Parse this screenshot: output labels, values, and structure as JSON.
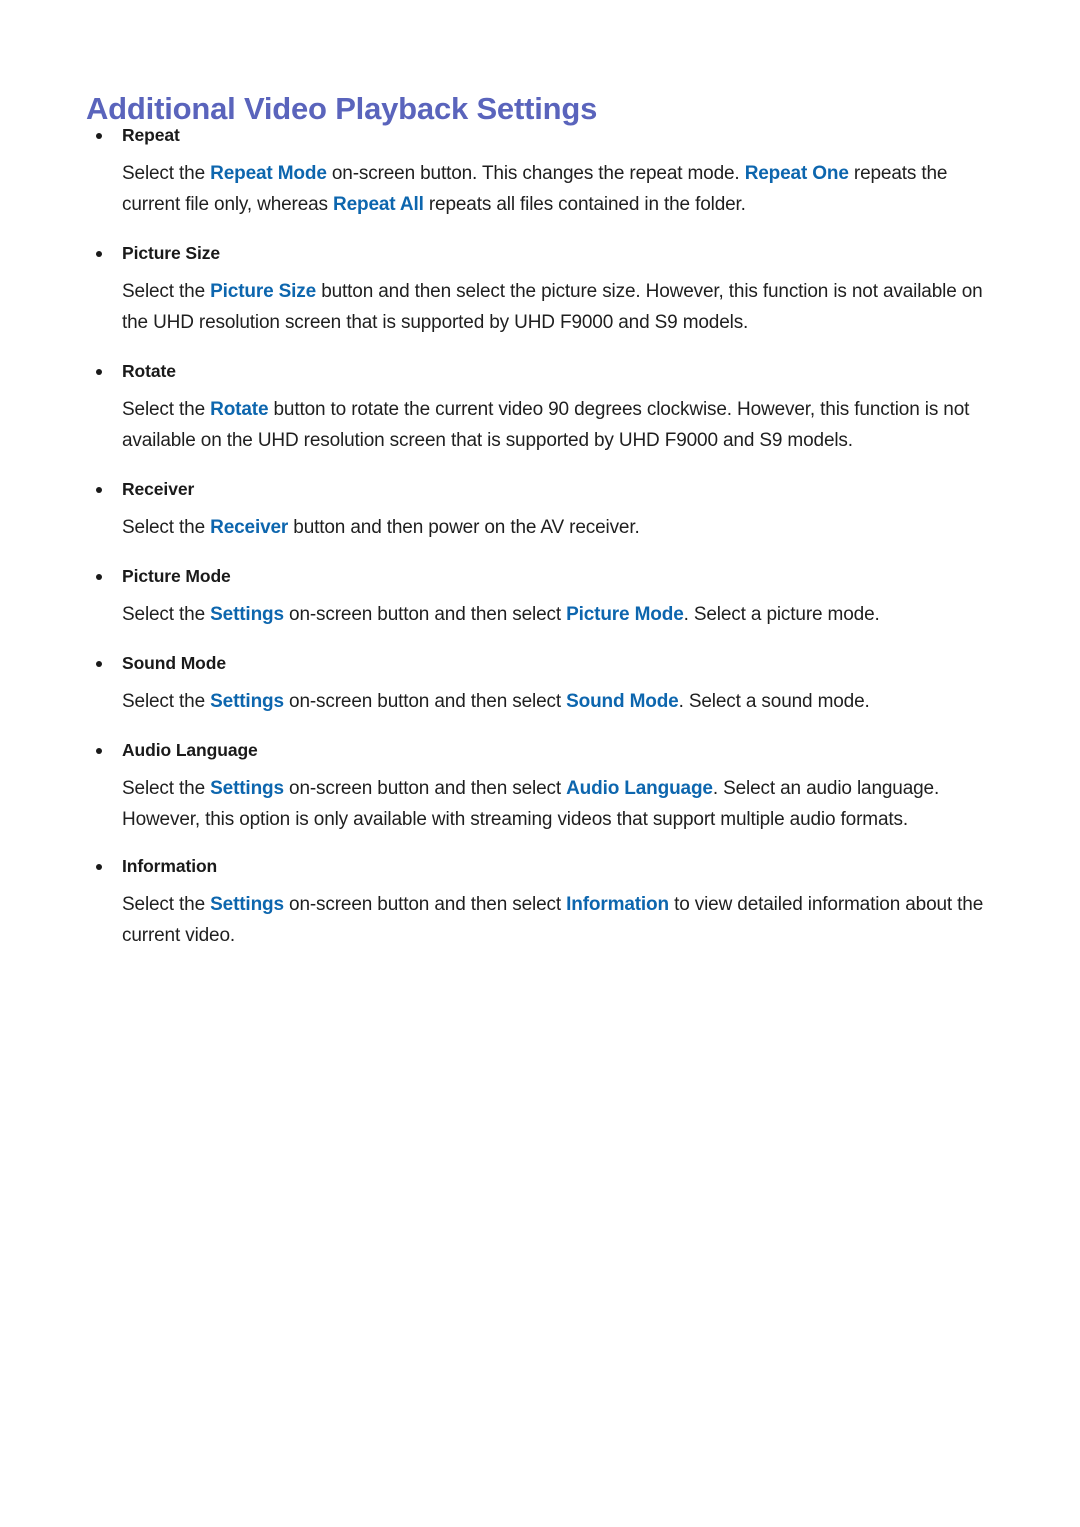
{
  "document": {
    "title": "Additional Video Playback Settings",
    "title_color": "#5a64bc",
    "highlight_color": "#0d66ae",
    "body_color": "#1f1f1f",
    "background_color": "#ffffff",
    "bullet_icon": "bullet-dot"
  },
  "sections": [
    {
      "id": "repeat",
      "label": "Repeat",
      "body": [
        {
          "t": "Select the ",
          "hl": false
        },
        {
          "t": "Repeat Mode",
          "hl": true
        },
        {
          "t": " on-screen button. This changes the repeat mode. ",
          "hl": false
        },
        {
          "t": "Repeat One",
          "hl": true
        },
        {
          "t": " repeats the current file only, whereas ",
          "hl": false
        },
        {
          "t": "Repeat All",
          "hl": true
        },
        {
          "t": " repeats all files contained in the folder.",
          "hl": false
        }
      ]
    },
    {
      "id": "picture-size",
      "label": "Picture Size",
      "body": [
        {
          "t": "Select the ",
          "hl": false
        },
        {
          "t": "Picture Size",
          "hl": true
        },
        {
          "t": " button and then select the picture size. However, this function is not available on the UHD resolution screen that is supported by UHD F9000 and S9 models.",
          "hl": false
        }
      ]
    },
    {
      "id": "rotate",
      "label": "Rotate",
      "body": [
        {
          "t": "Select the ",
          "hl": false
        },
        {
          "t": "Rotate",
          "hl": true
        },
        {
          "t": " button to rotate the current video 90 degrees clockwise. However, this function is not available on the UHD resolution screen that is supported by UHD F9000 and S9 models.",
          "hl": false
        }
      ]
    },
    {
      "id": "receiver",
      "label": "Receiver",
      "body": [
        {
          "t": "Select the ",
          "hl": false
        },
        {
          "t": "Receiver",
          "hl": true
        },
        {
          "t": " button and then power on the AV receiver.",
          "hl": false
        }
      ]
    },
    {
      "id": "picture-mode",
      "label": "Picture Mode",
      "body": [
        {
          "t": "Select the ",
          "hl": false
        },
        {
          "t": "Settings",
          "hl": true
        },
        {
          "t": " on-screen button and then select ",
          "hl": false
        },
        {
          "t": "Picture Mode",
          "hl": true
        },
        {
          "t": ". Select a picture mode.",
          "hl": false
        }
      ]
    },
    {
      "id": "sound-mode",
      "label": "Sound Mode",
      "body": [
        {
          "t": "Select the ",
          "hl": false
        },
        {
          "t": "Settings",
          "hl": true
        },
        {
          "t": " on-screen button and then select ",
          "hl": false
        },
        {
          "t": "Sound Mode",
          "hl": true
        },
        {
          "t": ". Select a sound mode.",
          "hl": false
        }
      ]
    },
    {
      "id": "audio-language",
      "label": "Audio Language",
      "body": [
        {
          "t": "Select the ",
          "hl": false
        },
        {
          "t": "Settings",
          "hl": true
        },
        {
          "t": " on-screen button and then select ",
          "hl": false
        },
        {
          "t": "Audio Language",
          "hl": true
        },
        {
          "t": ". Select an audio language. However, this option is only available with streaming videos that support multiple audio formats.",
          "hl": false
        }
      ]
    },
    {
      "id": "information",
      "label": "Information",
      "body": [
        {
          "t": "Select the ",
          "hl": false
        },
        {
          "t": "Settings",
          "hl": true
        },
        {
          "t": " on-screen button and then select ",
          "hl": false
        },
        {
          "t": "Information",
          "hl": true
        },
        {
          "t": " to view detailed information about the current video.",
          "hl": false
        }
      ]
    }
  ]
}
